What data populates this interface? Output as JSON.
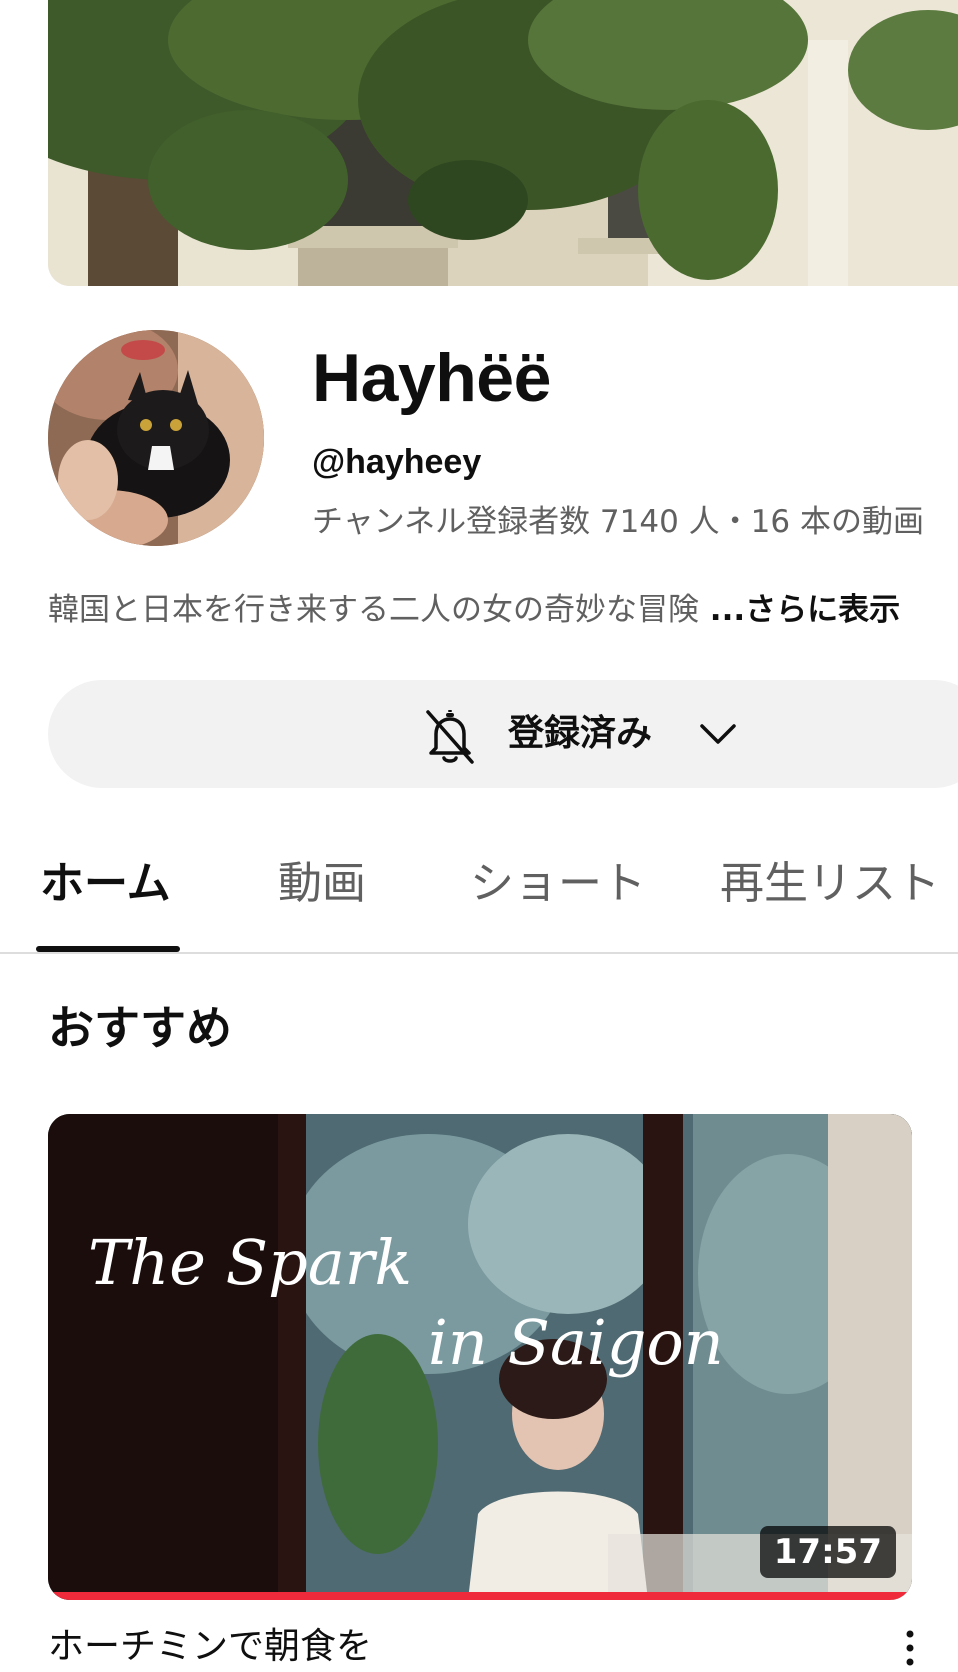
{
  "channel": {
    "name": "Hayhëë",
    "handle": "@hayheey",
    "stats": "チャンネル登録者数 7140 人・16 本の動画",
    "description": "韓国と日本を行き来する二人の女の奇妙な冒険",
    "description_more": " ...さらに表示"
  },
  "subscribe": {
    "label": "登録済み",
    "bell_icon": "bell-off-icon",
    "chevron_icon": "chevron-down-icon"
  },
  "tabs": [
    {
      "label": "ホーム",
      "active": true
    },
    {
      "label": "動画",
      "active": false
    },
    {
      "label": "ショート",
      "active": false
    },
    {
      "label": "再生リスト",
      "active": false
    }
  ],
  "section": {
    "title": "おすすめ"
  },
  "featured_video": {
    "thumbnail_text": "The Spark in Saigon",
    "duration": "17:57",
    "watched_fraction": 1.0,
    "title": "ホーチミンで朝食を"
  },
  "colors": {
    "progress": "#ef2a3a",
    "button_bg": "#f2f2f2",
    "secondary_text": "#606060"
  }
}
